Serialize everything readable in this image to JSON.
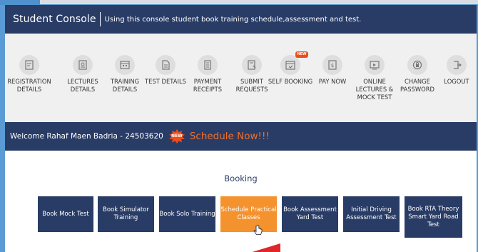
{
  "header": {
    "title": "Student Console",
    "subtitle": "Using this console student book training schedule,assessment and test."
  },
  "nav": {
    "items": [
      {
        "label": "REGISTRATION DETAILS",
        "icon": "registration-icon"
      },
      {
        "label": "LECTURES DETAILS",
        "icon": "lectures-icon"
      },
      {
        "label": "TRAINING DETAILS",
        "icon": "training-icon"
      },
      {
        "label": "TEST DETAILS",
        "icon": "test-icon"
      },
      {
        "label": "PAYMENT RECEIPTS",
        "icon": "receipt-icon"
      },
      {
        "label": "SUBMIT REQUESTS",
        "icon": "request-icon"
      },
      {
        "label": "SELF BOOKING",
        "icon": "calendar-icon",
        "badge": "NEW"
      },
      {
        "label": "PAY NOW",
        "icon": "pay-icon"
      },
      {
        "label": "ONLINE LECTURES & MOCK TEST",
        "icon": "online-lectures-icon"
      },
      {
        "label": "CHANGE PASSWORD",
        "icon": "password-icon"
      },
      {
        "label": "LOGOUT",
        "icon": "logout-icon"
      }
    ]
  },
  "welcome": {
    "text": "Welcome Rahaf Maen Badria - 24503620",
    "badge": "NEW",
    "cta": "Schedule Now!!!"
  },
  "booking": {
    "title": "Booking",
    "buttons": [
      {
        "label": "Book Mock Test"
      },
      {
        "label": "Book Simulator Training"
      },
      {
        "label": "Book Solo Training"
      },
      {
        "label": "Schedule Practical Classes",
        "active": true
      },
      {
        "label": "Book Assessment Yard Test"
      },
      {
        "label": "Initial Driving Assessment Test"
      },
      {
        "label": "Book RTA Theory Smart Yard Road Test"
      }
    ]
  },
  "colors": {
    "navy": "#293c66",
    "orange": "#f4922e",
    "accent_red": "#e94e1b",
    "background_blue": "#5b9bd5"
  }
}
